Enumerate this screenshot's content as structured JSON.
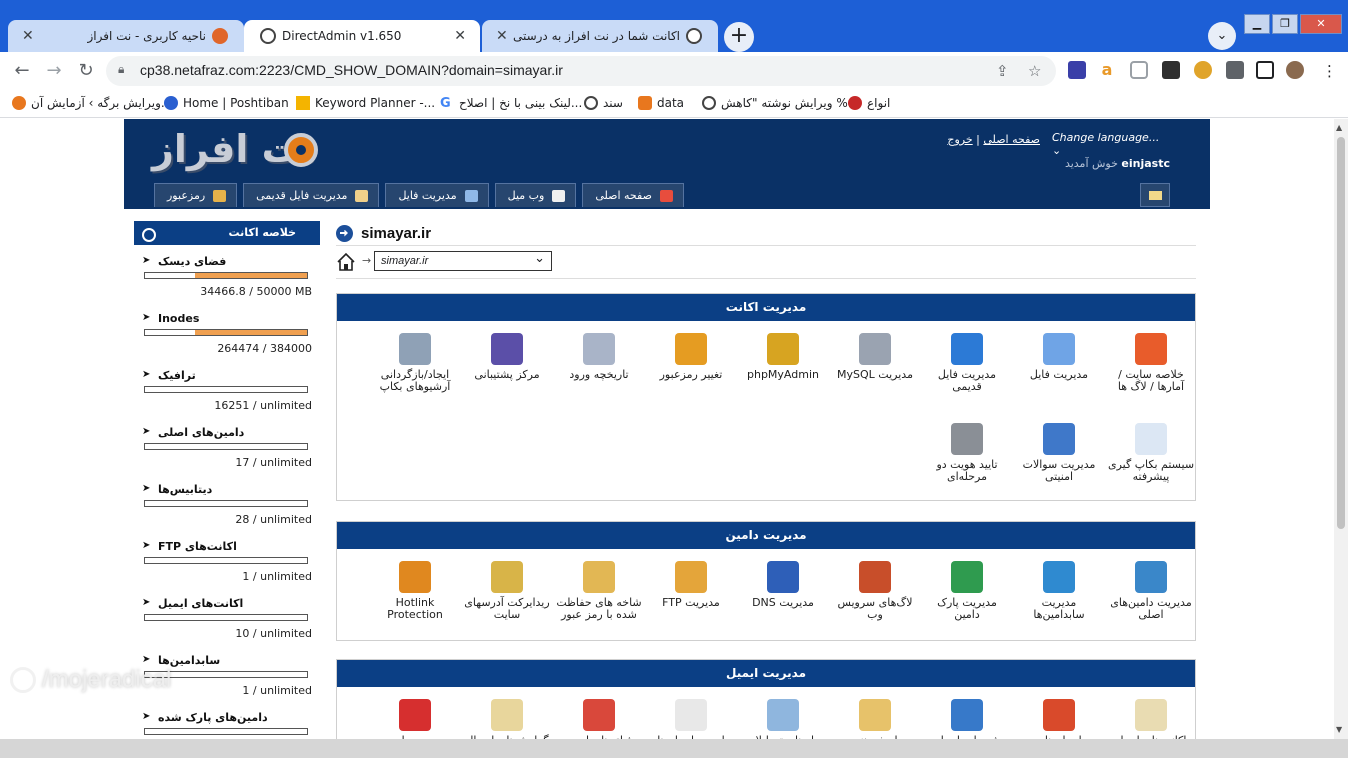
{
  "browser": {
    "tabs": [
      {
        "title": "ناحیه کاربری - نت افراز",
        "active": false
      },
      {
        "title": "DirectAdmin v1.650",
        "active": true
      },
      {
        "title": "اکانت شما در نت افراز به درستی ساخته ...",
        "active": false
      }
    ],
    "new_tab": "+",
    "url": "cp38.netafraz.com:2223/CMD_SHOW_DOMAIN?domain=simayar.ir",
    "bookmarks": [
      "ویرایش برگه › آزمایش آن...",
      "Home | Poshtiban",
      "Keyword Planner -...",
      "لینک بینی با نخ | اصلاح...",
      "سند",
      "data",
      "ویرایش نوشته \"کاهش %...",
      "انواع"
    ]
  },
  "header": {
    "logo_text": "نت افراز",
    "home_link": "صفحه اصلی",
    "logout_link": "خروج",
    "change_language": "Change language...",
    "welcome_prefix": "خوش آمدید",
    "username": "einjastc",
    "nav": [
      "صفحه اصلی",
      "وب میل",
      "مدیریت فایل",
      "مدیریت فایل قدیمی",
      "رمزعبور"
    ]
  },
  "sidebar": {
    "title": "خلاصه اکانت",
    "stats": [
      {
        "label": "فضای دیسک",
        "value": "34466.8 / 50000 MB",
        "fill": 0.69
      },
      {
        "label": "Inodes",
        "value": "264474 / 384000",
        "fill": 0.69
      },
      {
        "label": "ترافیک",
        "value": "16251 / unlimited",
        "fill": 0
      },
      {
        "label": "دامین‌های اصلی",
        "value": "17 / unlimited",
        "fill": 0
      },
      {
        "label": "دیتابیس‌ها",
        "value": "28 / unlimited",
        "fill": 0
      },
      {
        "label": "اکانت‌های FTP",
        "value": "1 / unlimited",
        "fill": 0
      },
      {
        "label": "اکانت‌های ایمیل",
        "value": "10 / unlimited",
        "fill": 0
      },
      {
        "label": "سابدامین‌ها",
        "value": "1 / unlimited",
        "fill": 0
      },
      {
        "label": "دامین‌های پارک شده",
        "value": "",
        "fill": 0
      }
    ]
  },
  "main": {
    "domain": "simayar.ir",
    "selected_domain": "simayar.ir",
    "sections": [
      {
        "title": "مدیریت اکانت",
        "items": [
          [
            "خلاصه سایت / آمارها / لاگ ها",
            "#e85c2b"
          ],
          [
            "مدیریت فایل",
            "#6fa4e6"
          ],
          [
            "مدیریت فایل قدیمی",
            "#2c7ad6"
          ],
          [
            "مدیریت MySQL",
            "#9aa3b1"
          ],
          [
            "phpMyAdmin",
            "#d7a421"
          ],
          [
            "تغییر رمزعبور",
            "#e59c22"
          ],
          [
            "تاریخچه ورود",
            "#a9b4c8"
          ],
          [
            "مرکز پشتیبانی",
            "#5b4fa8"
          ],
          [
            "ایجاد/بازگردانی آرشیوهای بکاپ",
            "#8fa1b6"
          ],
          [
            "سیستم بکاپ گیری پیشرفته",
            "#dce7f4"
          ],
          [
            "مدیریت سوالات امنیتی",
            "#3f78c9"
          ],
          [
            "تایید هویت دو مرحله‌ای",
            "#8a8f96"
          ]
        ]
      },
      {
        "title": "مدیریت دامین",
        "items": [
          [
            "مدیریت دامین‌های اصلی",
            "#3a87c9"
          ],
          [
            "مدیریت سابدامین‌ها",
            "#2f8ad0"
          ],
          [
            "مدیریت پارک دامین",
            "#2f9b4f"
          ],
          [
            "لاگ‌های سرویس وب",
            "#c84e2a"
          ],
          [
            "مدیریت DNS",
            "#2e5fb8"
          ],
          [
            "مدیریت FTP",
            "#e4a53a"
          ],
          [
            "شاخه های حفاظت شده با رمز عبور",
            "#e2b754"
          ],
          [
            "ریدایرکت آدرسهای سایت",
            "#d8b448"
          ],
          [
            "Hotlink Protection",
            "#e0881f"
          ]
        ]
      },
      {
        "title": "مدیریت ایمیل",
        "items": [
          [
            "اکانت‌های ایمیل",
            "#e9dcb2"
          ],
          [
            "ایمیل های",
            "#d94a2b"
          ],
          [
            "فوروارد ایمیل",
            "#3779c9"
          ],
          [
            "پاسخ دهنده",
            "#e7c26a"
          ],
          [
            "پیام‌های تعطیلات",
            "#8fb6de"
          ],
          [
            "لیست ایمیل ها",
            "#e8e8e8"
          ],
          [
            "فیلترهای اسپم",
            "#d9483b"
          ],
          [
            "گزارش‌های ارسال",
            "#e8d69c"
          ],
          [
            "وب میل",
            "#d62f2f"
          ]
        ]
      }
    ]
  },
  "watermark": "/mojeradical"
}
